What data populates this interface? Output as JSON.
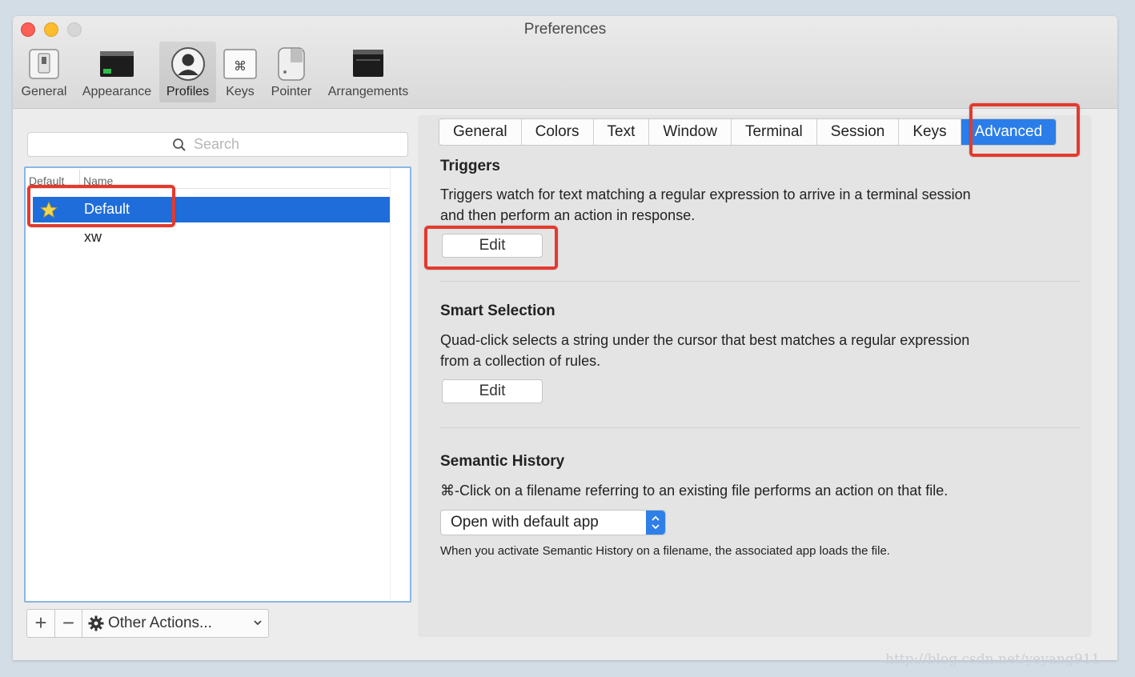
{
  "window": {
    "title": "Preferences"
  },
  "toolbar": {
    "items": [
      {
        "label": "General",
        "icon": "switch-icon"
      },
      {
        "label": "Appearance",
        "icon": "monitor-icon"
      },
      {
        "label": "Profiles",
        "icon": "person-icon",
        "active": true
      },
      {
        "label": "Keys",
        "icon": "command-key-icon"
      },
      {
        "label": "Pointer",
        "icon": "mouse-icon"
      },
      {
        "label": "Arrangements",
        "icon": "windows-icon"
      }
    ]
  },
  "sidebar": {
    "search_placeholder": "Search",
    "columns": [
      "Default",
      "Name"
    ],
    "profiles": [
      {
        "name": "Default",
        "is_default": true,
        "selected": true
      },
      {
        "name": "xw",
        "is_default": false,
        "selected": false
      }
    ],
    "add_label": "+",
    "remove_label": "−",
    "other_actions_label": "Other Actions..."
  },
  "tabs": [
    "General",
    "Colors",
    "Text",
    "Window",
    "Terminal",
    "Session",
    "Keys",
    "Advanced"
  ],
  "active_tab": "Advanced",
  "sections": {
    "triggers": {
      "title": "Triggers",
      "line1": "Triggers watch for text matching a regular expression to arrive in a terminal session",
      "line2": "and then perform an action in response.",
      "button": "Edit"
    },
    "smart_selection": {
      "title": "Smart Selection",
      "line1": "Quad-click selects a string under the cursor that best matches a regular expression",
      "line2": "from a collection of rules.",
      "button": "Edit"
    },
    "semantic_history": {
      "title": "Semantic History",
      "description": "⌘-Click on a filename referring to an existing file performs an action on that file.",
      "select_value": "Open with default app",
      "note": "When you activate Semantic History on a filename, the associated app loads the file."
    }
  },
  "colors": {
    "accent": "#2b7de9",
    "selection": "#1f6ddb",
    "highlight": "#e33a2d"
  },
  "watermark": "http://blog.csdn.net/yeyang911"
}
